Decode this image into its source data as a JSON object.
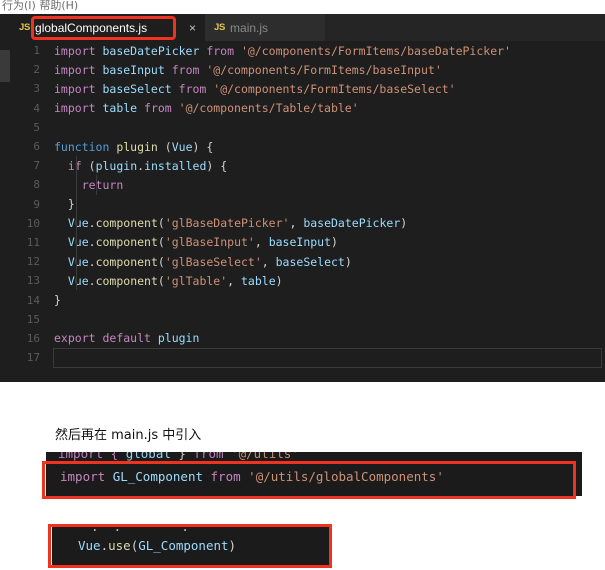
{
  "menu_strip": {
    "text": "行为(I)  帮助(H)"
  },
  "editor": {
    "tabs": [
      {
        "label": "globalComponents.js",
        "icon": "js-file-icon",
        "badge": "JS",
        "active": true,
        "close_icon": "×"
      },
      {
        "label": "main.js",
        "icon": "js-file-icon",
        "badge": "JS",
        "active": false,
        "close_icon": ""
      }
    ],
    "lines": [
      {
        "n": "1",
        "tokens": [
          {
            "t": "import ",
            "c": "t-kw"
          },
          {
            "t": "baseDatePicker ",
            "c": "t-var"
          },
          {
            "t": "from ",
            "c": "t-kw"
          },
          {
            "t": "'@/components/FormItems/baseDatePicker'",
            "c": "t-str"
          }
        ]
      },
      {
        "n": "2",
        "tokens": [
          {
            "t": "import ",
            "c": "t-kw"
          },
          {
            "t": "baseInput ",
            "c": "t-var"
          },
          {
            "t": "from ",
            "c": "t-kw"
          },
          {
            "t": "'@/components/FormItems/baseInput'",
            "c": "t-str"
          }
        ]
      },
      {
        "n": "3",
        "tokens": [
          {
            "t": "import ",
            "c": "t-kw"
          },
          {
            "t": "baseSelect ",
            "c": "t-var"
          },
          {
            "t": "from ",
            "c": "t-kw"
          },
          {
            "t": "'@/components/FormItems/baseSelect'",
            "c": "t-str"
          }
        ]
      },
      {
        "n": "4",
        "tokens": [
          {
            "t": "import ",
            "c": "t-kw"
          },
          {
            "t": "table ",
            "c": "t-var"
          },
          {
            "t": "from ",
            "c": "t-kw"
          },
          {
            "t": "'@/components/Table/table'",
            "c": "t-str"
          }
        ]
      },
      {
        "n": "5",
        "tokens": []
      },
      {
        "n": "6",
        "tokens": [
          {
            "t": "function ",
            "c": "t-fn"
          },
          {
            "t": "plugin ",
            "c": "t-yellow"
          },
          {
            "t": "(",
            "c": "t-plain"
          },
          {
            "t": "Vue",
            "c": "t-var"
          },
          {
            "t": ") {",
            "c": "t-plain"
          }
        ]
      },
      {
        "n": "7",
        "tokens": [
          {
            "t": "  ",
            "c": "t-plain"
          },
          {
            "t": "if ",
            "c": "t-ctrl"
          },
          {
            "t": "(",
            "c": "t-plain"
          },
          {
            "t": "plugin",
            "c": "t-var"
          },
          {
            "t": ".",
            "c": "t-plain"
          },
          {
            "t": "installed",
            "c": "t-var"
          },
          {
            "t": ") {",
            "c": "t-plain"
          }
        ]
      },
      {
        "n": "8",
        "tokens": [
          {
            "t": "    ",
            "c": "t-plain"
          },
          {
            "t": "return",
            "c": "t-ctrl"
          }
        ]
      },
      {
        "n": "9",
        "tokens": [
          {
            "t": "  }",
            "c": "t-plain"
          }
        ]
      },
      {
        "n": "10",
        "tokens": [
          {
            "t": "  ",
            "c": "t-plain"
          },
          {
            "t": "Vue",
            "c": "t-var"
          },
          {
            "t": ".",
            "c": "t-plain"
          },
          {
            "t": "component",
            "c": "t-yellow"
          },
          {
            "t": "(",
            "c": "t-plain"
          },
          {
            "t": "'glBaseDatePicker'",
            "c": "t-str"
          },
          {
            "t": ", ",
            "c": "t-plain"
          },
          {
            "t": "baseDatePicker",
            "c": "t-var"
          },
          {
            "t": ")",
            "c": "t-plain"
          }
        ]
      },
      {
        "n": "11",
        "tokens": [
          {
            "t": "  ",
            "c": "t-plain"
          },
          {
            "t": "Vue",
            "c": "t-var"
          },
          {
            "t": ".",
            "c": "t-plain"
          },
          {
            "t": "component",
            "c": "t-yellow"
          },
          {
            "t": "(",
            "c": "t-plain"
          },
          {
            "t": "'glBaseInput'",
            "c": "t-str"
          },
          {
            "t": ", ",
            "c": "t-plain"
          },
          {
            "t": "baseInput",
            "c": "t-var"
          },
          {
            "t": ")",
            "c": "t-plain"
          }
        ]
      },
      {
        "n": "12",
        "tokens": [
          {
            "t": "  ",
            "c": "t-plain"
          },
          {
            "t": "Vue",
            "c": "t-var"
          },
          {
            "t": ".",
            "c": "t-plain"
          },
          {
            "t": "component",
            "c": "t-yellow"
          },
          {
            "t": "(",
            "c": "t-plain"
          },
          {
            "t": "'glBaseSelect'",
            "c": "t-str"
          },
          {
            "t": ", ",
            "c": "t-plain"
          },
          {
            "t": "baseSelect",
            "c": "t-var"
          },
          {
            "t": ")",
            "c": "t-plain"
          }
        ]
      },
      {
        "n": "13",
        "tokens": [
          {
            "t": "  ",
            "c": "t-plain"
          },
          {
            "t": "Vue",
            "c": "t-var"
          },
          {
            "t": ".",
            "c": "t-plain"
          },
          {
            "t": "component",
            "c": "t-yellow"
          },
          {
            "t": "(",
            "c": "t-plain"
          },
          {
            "t": "'glTable'",
            "c": "t-str"
          },
          {
            "t": ", ",
            "c": "t-plain"
          },
          {
            "t": "table",
            "c": "t-var"
          },
          {
            "t": ")",
            "c": "t-plain"
          }
        ]
      },
      {
        "n": "14",
        "tokens": [
          {
            "t": "}",
            "c": "t-plain"
          }
        ]
      },
      {
        "n": "15",
        "tokens": []
      },
      {
        "n": "16",
        "tokens": [
          {
            "t": "export ",
            "c": "t-kw"
          },
          {
            "t": "default ",
            "c": "t-kw"
          },
          {
            "t": "plugin",
            "c": "t-var"
          }
        ]
      },
      {
        "n": "17",
        "tokens": [],
        "current": true
      }
    ]
  },
  "caption": {
    "text": "然后再在 main.js  中引入"
  },
  "snippet1": {
    "clipped_line": [
      {
        "t": "import { ",
        "c": "t-kw"
      },
      {
        "t": "global",
        "c": "t-var"
      },
      {
        "t": " } ",
        "c": "t-plain"
      },
      {
        "t": "from ",
        "c": "t-kw"
      },
      {
        "t": "'@/utils'",
        "c": "t-str"
      }
    ],
    "main_line": [
      {
        "t": "import ",
        "c": "t-kw"
      },
      {
        "t": "GL_Component ",
        "c": "t-var"
      },
      {
        "t": "from ",
        "c": "t-kw"
      },
      {
        "t": "'@/utils/globalComponents'",
        "c": "t-str"
      }
    ]
  },
  "snippet2": {
    "clipped_line": [
      {
        "t": "  .  .        .",
        "c": "t-plain"
      }
    ],
    "main_line": [
      {
        "t": "Vue",
        "c": "t-var"
      },
      {
        "t": ".",
        "c": "t-plain"
      },
      {
        "t": "use",
        "c": "t-yellow"
      },
      {
        "t": "(",
        "c": "t-plain"
      },
      {
        "t": "GL_Component",
        "c": "t-var"
      },
      {
        "t": ")",
        "c": "t-plain"
      }
    ]
  },
  "colors": {
    "annotation_red": "#f0321e",
    "editor_bg": "#1e1e1e",
    "tabbar_bg": "#252526",
    "active_tab_bg": "#1e1e1e",
    "inactive_tab_bg": "#2d2d2d",
    "js_badge": "#e2c54e",
    "string": "#ce9178",
    "keyword": "#c586c0",
    "identifier": "#9cdcfe",
    "function": "#dcdcaa"
  }
}
